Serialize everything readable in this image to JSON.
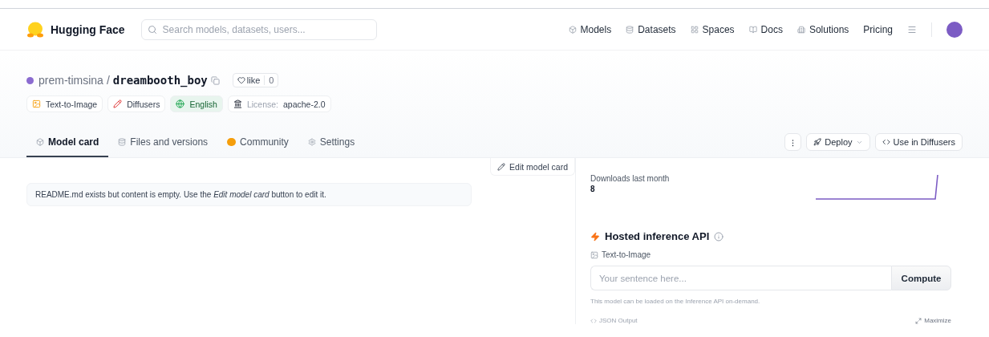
{
  "navbar": {
    "brand": "Hugging Face",
    "search": {
      "placeholder": "Search models, datasets, users..."
    },
    "links": [
      {
        "label": "Models",
        "kind": "models"
      },
      {
        "label": "Datasets",
        "kind": "datasets"
      },
      {
        "label": "Spaces",
        "kind": "spaces"
      },
      {
        "label": "Docs",
        "kind": "docs"
      },
      {
        "label": "Solutions",
        "kind": "solutions"
      },
      {
        "label": "Pricing",
        "kind": "plain"
      }
    ]
  },
  "repo": {
    "owner": "prem-timsina",
    "separator": "/",
    "name": "dreambooth_boy",
    "like": {
      "label": "like",
      "count": "0"
    },
    "tags": [
      {
        "kind": "task",
        "label": "Text-to-Image"
      },
      {
        "kind": "library",
        "label": "Diffusers"
      },
      {
        "kind": "language",
        "label": "English"
      },
      {
        "kind": "license",
        "prefix": "License:",
        "label": "apache-2.0"
      }
    ],
    "tabs": [
      {
        "label": "Model card",
        "kind": "card",
        "selected": true
      },
      {
        "label": "Files and versions",
        "kind": "files",
        "selected": false
      },
      {
        "label": "Community",
        "kind": "community",
        "selected": false
      },
      {
        "label": "Settings",
        "kind": "settings",
        "selected": false
      }
    ],
    "actions": [
      {
        "kind": "more",
        "label": "⁝"
      },
      {
        "kind": "deploy",
        "label": "Deploy"
      },
      {
        "kind": "code",
        "label": "Use in Diffusers"
      }
    ]
  },
  "model_card": {
    "edit_button": "Edit model card",
    "notice": "README.md exists but content is empty. Use the *Edit model card* button to edit it."
  },
  "downloads": {
    "label": "Downloads last month",
    "value": "8"
  },
  "inference": {
    "title": "Hosted inference API",
    "task": "Text-to-Image",
    "input": {
      "placeholder": "Your sentence here..."
    },
    "button": "Compute",
    "note": "This model can be loaded on the Inference API on-demand.",
    "json_output": "JSON Output",
    "maximize": "Maximize"
  }
}
